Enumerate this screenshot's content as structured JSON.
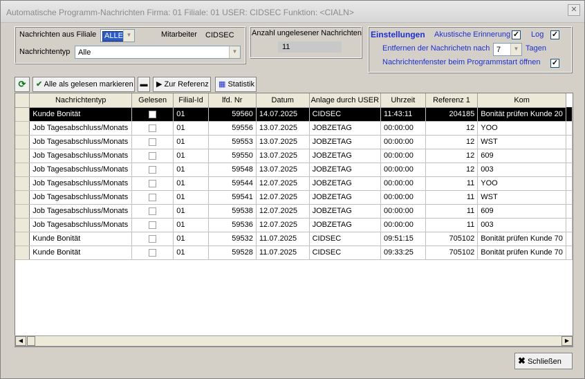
{
  "window": {
    "title": "Automatische Programm-Nachrichten Firma: 01 Filiale: 01 USER: CIDSEC Funktion: <CIALN>"
  },
  "filter": {
    "filiale_label": "Nachrichten aus Filiale",
    "filiale_value": "ALLE",
    "mitarbeiter_label": "Mitarbeiter",
    "mitarbeiter_value": "CIDSEC",
    "typ_label": "Nachrichtentyp",
    "typ_value": "Alle"
  },
  "unread": {
    "label": "Anzahl ungelesener Nachrichten",
    "value": "11"
  },
  "settings": {
    "title": "Einstellungen",
    "acoustic_label": "Akustische Erinnerung",
    "acoustic_checked": true,
    "log_label": "Log",
    "log_checked": true,
    "remove_label": "Entfernen der Nachrichetn nach",
    "remove_value": "7",
    "remove_unit": "Tagen",
    "open_label": "Nachrichtenfenster beim Programmstart öffnen",
    "open_checked": true
  },
  "toolbar": {
    "mark_all_label": "Alle als gelesen markieren",
    "reference_label": "Zur Referenz",
    "stats_label": "Statistik"
  },
  "table": {
    "columns": [
      "Nachrichtentyp",
      "Gelesen",
      "Filial-Id",
      "lfd. Nr",
      "Datum",
      "Anlage durch USER",
      "Uhrzeit",
      "Referenz 1",
      "Kom"
    ],
    "rows": [
      [
        "Kunde Bonität",
        "",
        "01",
        "59560",
        "14.07.2025",
        "CIDSEC",
        "11:43:11",
        "204185",
        "Bonität prüfen Kunde 20"
      ],
      [
        "Job Tagesabschluss/Monats",
        "",
        "01",
        "59556",
        "13.07.2025",
        "JOBZETAG",
        "00:00:00",
        "12",
        "YOO"
      ],
      [
        "Job Tagesabschluss/Monats",
        "",
        "01",
        "59553",
        "13.07.2025",
        "JOBZETAG",
        "00:00:00",
        "12",
        "WST"
      ],
      [
        "Job Tagesabschluss/Monats",
        "",
        "01",
        "59550",
        "13.07.2025",
        "JOBZETAG",
        "00:00:00",
        "12",
        "609"
      ],
      [
        "Job Tagesabschluss/Monats",
        "",
        "01",
        "59548",
        "13.07.2025",
        "JOBZETAG",
        "00:00:00",
        "12",
        "003"
      ],
      [
        "Job Tagesabschluss/Monats",
        "",
        "01",
        "59544",
        "12.07.2025",
        "JOBZETAG",
        "00:00:00",
        "11",
        "YOO"
      ],
      [
        "Job Tagesabschluss/Monats",
        "",
        "01",
        "59541",
        "12.07.2025",
        "JOBZETAG",
        "00:00:00",
        "11",
        "WST"
      ],
      [
        "Job Tagesabschluss/Monats",
        "",
        "01",
        "59538",
        "12.07.2025",
        "JOBZETAG",
        "00:00:00",
        "11",
        "609"
      ],
      [
        "Job Tagesabschluss/Monats",
        "",
        "01",
        "59536",
        "12.07.2025",
        "JOBZETAG",
        "00:00:00",
        "11",
        "003"
      ],
      [
        "Kunde Bonität",
        "",
        "01",
        "59532",
        "11.07.2025",
        "CIDSEC",
        "09:51:15",
        "705102",
        "Bonität prüfen Kunde 70"
      ],
      [
        "Kunde Bonität",
        "",
        "01",
        "59528",
        "11.07.2025",
        "CIDSEC",
        "09:33:25",
        "705102",
        "Bonität prüfen Kunde 70"
      ]
    ]
  },
  "footer": {
    "close_label": "Schließen"
  }
}
